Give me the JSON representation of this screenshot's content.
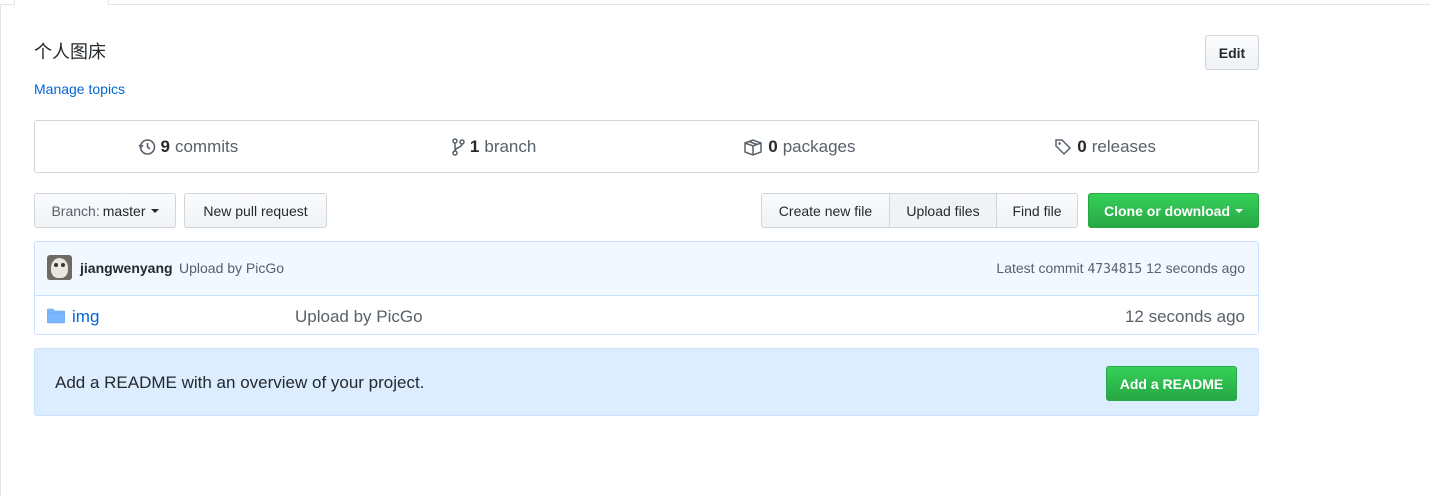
{
  "repo": {
    "description": "个人图床",
    "manage_topics": "Manage topics",
    "edit_label": "Edit"
  },
  "summary": {
    "commits": {
      "count": "9",
      "label": "commits",
      "icon": "history-icon"
    },
    "branches": {
      "count": "1",
      "label": "branch",
      "icon": "git-branch-icon"
    },
    "packages": {
      "count": "0",
      "label": "packages",
      "icon": "package-icon"
    },
    "releases": {
      "count": "0",
      "label": "releases",
      "icon": "tag-icon"
    }
  },
  "toolbar": {
    "branch_key": "Branch:",
    "branch_value": "master",
    "new_pr": "New pull request",
    "create_file": "Create new file",
    "upload_files": "Upload files",
    "find_file": "Find file",
    "clone": "Clone or download"
  },
  "commit": {
    "author": "jiangwenyang",
    "message": "Upload by PicGo",
    "latest_label": "Latest commit",
    "sha": "4734815",
    "age": "12 seconds ago"
  },
  "files": [
    {
      "name": "img",
      "message": "Upload by PicGo",
      "age": "12 seconds ago",
      "icon": "folder-icon"
    }
  ],
  "readme": {
    "text": "Add a README with an overview of your project.",
    "button": "Add a README"
  },
  "colors": {
    "link": "#0366d6",
    "primary_green": "#28a745",
    "readme_bg": "#dbedff",
    "commit_bg": "#f1f8ff"
  }
}
